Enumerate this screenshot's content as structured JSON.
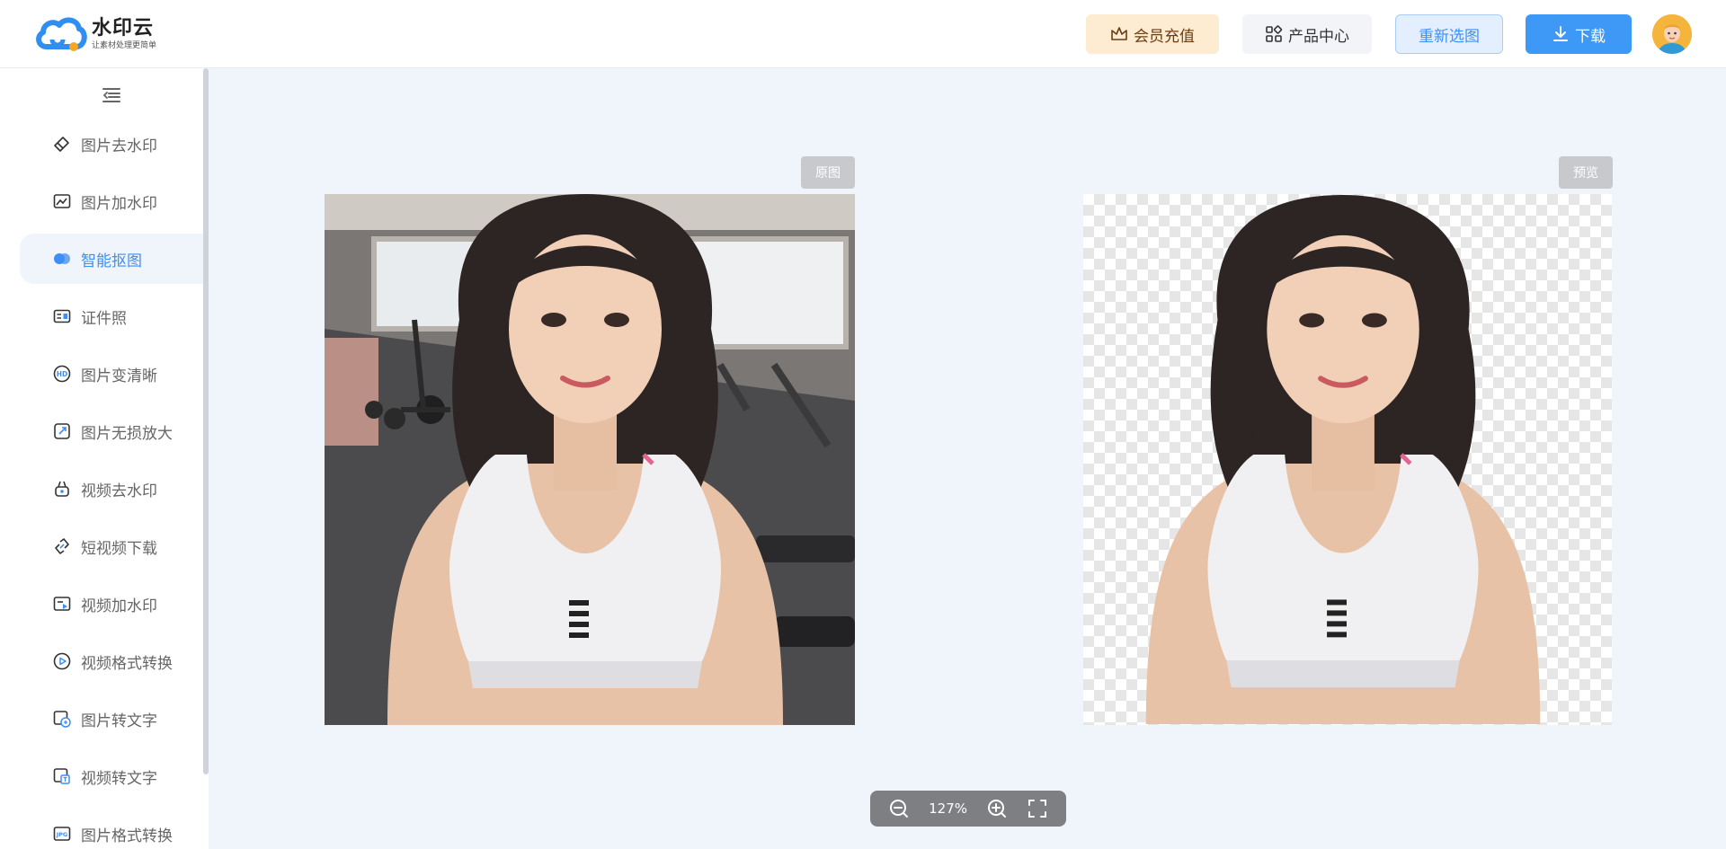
{
  "app": {
    "brand": "水印云",
    "slogan": "让素材处理更简单"
  },
  "header": {
    "vip_label": "会员充值",
    "product_label": "产品中心",
    "reselect_label": "重新选图",
    "download_label": "下载"
  },
  "sidebar": {
    "items": [
      {
        "label": "图片去水印",
        "icon": "eraser-icon"
      },
      {
        "label": "图片加水印",
        "icon": "image-edit-icon"
      },
      {
        "label": "智能抠图",
        "icon": "cutout-icon",
        "active": true
      },
      {
        "label": "证件照",
        "icon": "id-card-icon"
      },
      {
        "label": "图片变清晰",
        "icon": "hd-icon"
      },
      {
        "label": "图片无损放大",
        "icon": "enlarge-icon"
      },
      {
        "label": "视频去水印",
        "icon": "video-eraser-icon"
      },
      {
        "label": "短视频下载",
        "icon": "link-icon"
      },
      {
        "label": "视频加水印",
        "icon": "video-watermark-icon"
      },
      {
        "label": "视频格式转换",
        "icon": "play-circle-icon"
      },
      {
        "label": "图片转文字",
        "icon": "image-text-icon"
      },
      {
        "label": "视频转文字",
        "icon": "video-text-icon"
      },
      {
        "label": "图片格式转换",
        "icon": "jpg-icon"
      }
    ]
  },
  "panels": {
    "original_label": "原图",
    "preview_label": "预览"
  },
  "zoom": {
    "level": "127%"
  },
  "colors": {
    "accent": "#3d8ff5",
    "vip_bg": "#fdebd2",
    "canvas_bg": "#f0f4fb"
  }
}
